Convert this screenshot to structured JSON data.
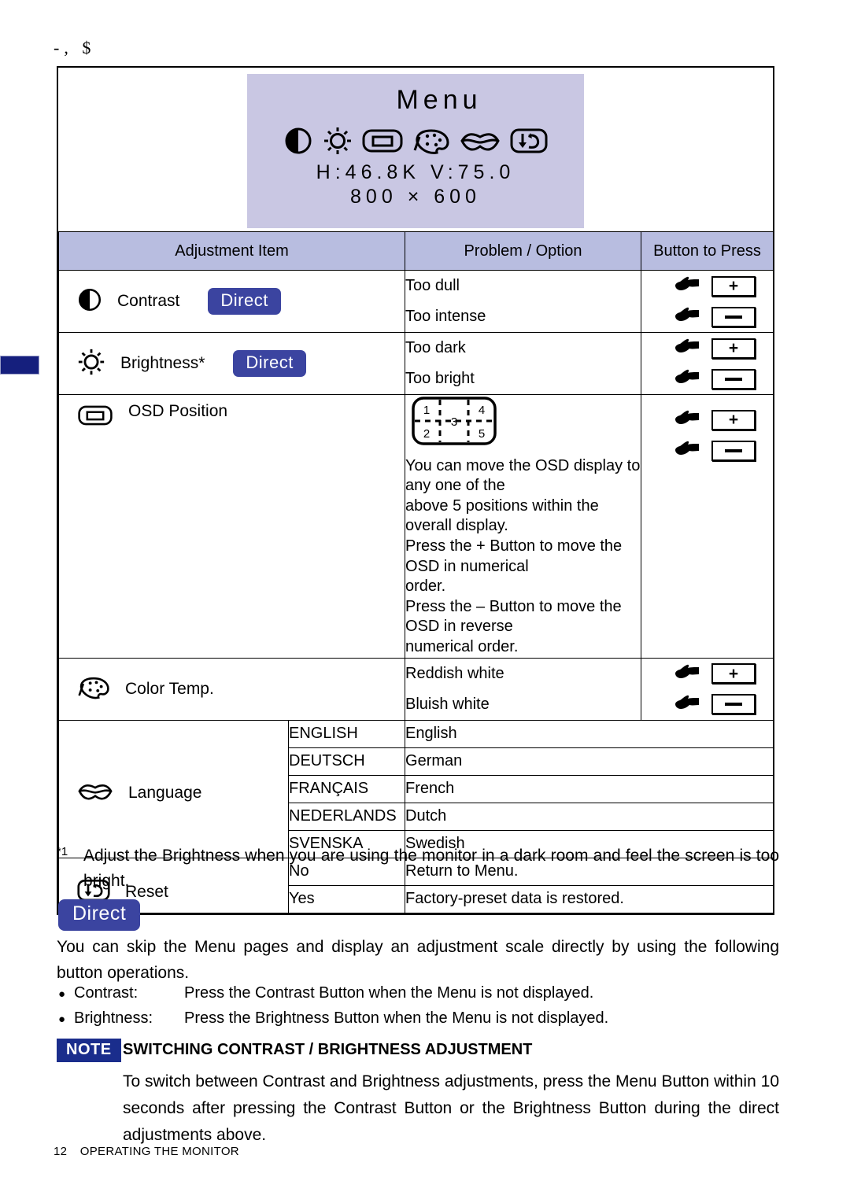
{
  "top_code": "-,  $",
  "osd": {
    "title": "Menu",
    "icons": [
      "contrast-icon",
      "brightness-icon",
      "osd-position-icon",
      "color-temp-icon",
      "language-icon",
      "reset-icon"
    ],
    "freq_line": "H:46.8K   V:75.0",
    "resolution_line": "800 × 600",
    "bg_color": "#c9c7e3"
  },
  "table": {
    "headers": {
      "item": "Adjustment Item",
      "problem": "Problem / Option",
      "button": "Button to Press"
    },
    "rows": [
      {
        "icon": "contrast-icon",
        "label": "Contrast",
        "badge": "Direct",
        "options": [
          "Too dull",
          "Too intense"
        ],
        "buttons": [
          "+",
          "-"
        ]
      },
      {
        "icon": "brightness-icon",
        "label": "Brightness*",
        "badge": "Direct",
        "options": [
          "Too dark",
          "Too bright"
        ],
        "buttons": [
          "+",
          "-"
        ]
      },
      {
        "icon": "osd-position-icon",
        "label": "OSD Position",
        "diagram_numbers": [
          "1",
          "4",
          "3",
          "2",
          "5"
        ],
        "buttons": [
          "+",
          "-"
        ],
        "description": [
          "You can move the OSD display to any one of the",
          "above 5 positions within the overall display.",
          "Press the + Button to move the OSD in numerical",
          "order.",
          "Press the – Button to move the OSD in reverse",
          "numerical order."
        ]
      },
      {
        "icon": "color-temp-icon",
        "label": "Color Temp.",
        "options": [
          "Reddish white",
          "Bluish white"
        ],
        "buttons": [
          "+",
          "-"
        ]
      }
    ],
    "language": {
      "icon": "language-icon",
      "label": "Language",
      "options": [
        {
          "name": "ENGLISH",
          "desc": "English"
        },
        {
          "name": "DEUTSCH",
          "desc": "German"
        },
        {
          "name": "FRANÇAIS",
          "desc": "French"
        },
        {
          "name": "NEDERLANDS",
          "desc": "Dutch"
        },
        {
          "name": "SVENSKA",
          "desc": "Swedish"
        }
      ]
    },
    "reset": {
      "icon": "reset-icon",
      "label": "Reset",
      "options": [
        {
          "name": "No",
          "desc": "Return to Menu."
        },
        {
          "name": "Yes",
          "desc": "Factory-preset data is restored."
        }
      ]
    }
  },
  "footnote": {
    "marker": "*1",
    "text": "Adjust the Brightness when you are using the monitor in a dark room and feel the screen is too bright."
  },
  "direct_section": {
    "badge": "Direct",
    "paragraph": "You can skip the Menu pages and display an adjustment scale directly by using the following button operations.",
    "bullets": [
      {
        "key": "Contrast:",
        "text": "Press the Contrast Button when the Menu is not displayed."
      },
      {
        "key": "Brightness:",
        "text": "Press the Brightness Button when the Menu is not displayed."
      }
    ]
  },
  "note": {
    "badge": "NOTE",
    "title": "SWITCHING CONTRAST / BRIGHTNESS ADJUSTMENT",
    "body": "To switch between Contrast and Brightness adjustments, press the Menu Button within 10 seconds after pressing the Contrast Button or the Brightness Button during the direct adjustments above."
  },
  "page_footer": {
    "page_number": "12",
    "section": "OPERATING THE MONITOR"
  },
  "colors": {
    "osd_bg": "#c9c7e3",
    "table_header_bg": "#b8bde0",
    "direct_badge": "#3b44a0",
    "note_badge": "#1a2d8c",
    "edge_tab": "#151f7d"
  }
}
